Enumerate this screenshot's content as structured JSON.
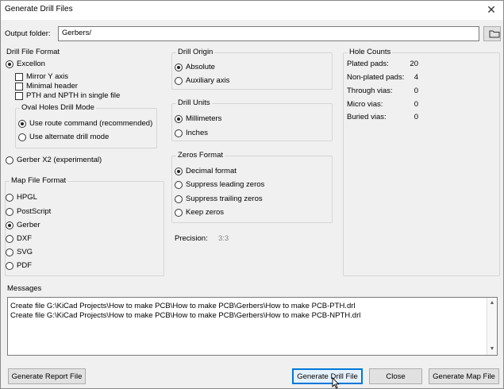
{
  "window": {
    "title": "Generate Drill Files"
  },
  "output_folder": {
    "label": "Output folder:",
    "value": "Gerbers/"
  },
  "drill_file_format": {
    "title": "Drill File Format",
    "excellon": "Excellon",
    "mirror_y": "Mirror Y axis",
    "minimal_header": "Minimal header",
    "pth_npth_single": "PTH and NPTH in single file",
    "oval_holes": {
      "title": "Oval Holes Drill Mode",
      "route": "Use route command (recommended)",
      "alternate": "Use alternate drill mode"
    },
    "gerber_x2": "Gerber X2 (experimental)"
  },
  "map_file_format": {
    "title": "Map File Format",
    "options": [
      "HPGL",
      "PostScript",
      "Gerber",
      "DXF",
      "SVG",
      "PDF"
    ],
    "selected": "Gerber"
  },
  "drill_origin": {
    "title": "Drill Origin",
    "absolute": "Absolute",
    "auxiliary": "Auxiliary axis"
  },
  "drill_units": {
    "title": "Drill Units",
    "mm": "Millimeters",
    "inches": "Inches"
  },
  "zeros_format": {
    "title": "Zeros Format",
    "decimal": "Decimal format",
    "suppress_leading": "Suppress leading zeros",
    "suppress_trailing": "Suppress trailing zeros",
    "keep": "Keep zeros"
  },
  "precision": {
    "label": "Precision:",
    "value": "3:3"
  },
  "hole_counts": {
    "title": "Hole Counts",
    "plated_label": "Plated pads:",
    "plated": "20",
    "nonplated_label": "Non-plated pads:",
    "nonplated": "4",
    "through_label": "Through vias:",
    "through": "0",
    "micro_label": "Micro vias:",
    "micro": "0",
    "buried_label": "Buried vias:",
    "buried": "0"
  },
  "messages": {
    "title": "Messages",
    "lines": [
      "Create file G:\\KiCad Projects\\How to make PCB\\How to make PCB\\Gerbers\\How to make PCB-PTH.drl",
      "Create file G:\\KiCad Projects\\How to make PCB\\How to make PCB\\Gerbers\\How to make PCB-NPTH.drl"
    ]
  },
  "buttons": {
    "report": "Generate Report File",
    "drill": "Generate Drill File",
    "close": "Close",
    "map": "Generate Map File"
  },
  "icons": {
    "folder": "folder-icon",
    "close": "close-icon",
    "cursor": "mouse-cursor-icon"
  }
}
